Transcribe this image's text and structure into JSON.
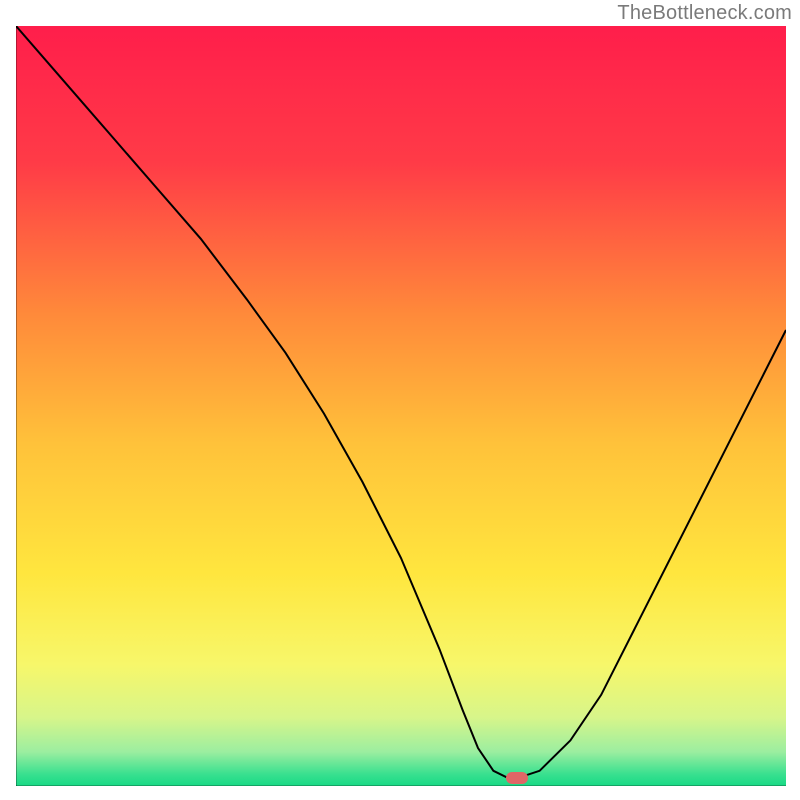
{
  "watermark": "TheBottleneck.com",
  "chart_data": {
    "type": "line",
    "title": "",
    "xlabel": "",
    "ylabel": "",
    "xlim": [
      0,
      100
    ],
    "ylim": [
      0,
      100
    ],
    "series": [
      {
        "name": "curve",
        "x": [
          0,
          6,
          12,
          18,
          24,
          30,
          35,
          40,
          45,
          50,
          55,
          58,
          60,
          62,
          64,
          65,
          68,
          72,
          76,
          80,
          84,
          88,
          92,
          96,
          100
        ],
        "y": [
          100,
          93,
          86,
          79,
          72,
          64,
          57,
          49,
          40,
          30,
          18,
          10,
          5,
          2,
          1,
          1,
          2,
          6,
          12,
          20,
          28,
          36,
          44,
          52,
          60
        ]
      }
    ],
    "marker": {
      "x": 65,
      "y": 1
    },
    "background_gradient": {
      "stops": [
        {
          "offset": 0,
          "color": "#ff1e4b"
        },
        {
          "offset": 0.18,
          "color": "#ff3b47"
        },
        {
          "offset": 0.38,
          "color": "#ff8a3a"
        },
        {
          "offset": 0.55,
          "color": "#ffc23a"
        },
        {
          "offset": 0.72,
          "color": "#ffe63e"
        },
        {
          "offset": 0.84,
          "color": "#f7f76a"
        },
        {
          "offset": 0.91,
          "color": "#d7f58a"
        },
        {
          "offset": 0.955,
          "color": "#9ceea0"
        },
        {
          "offset": 0.985,
          "color": "#37e08f"
        },
        {
          "offset": 1.0,
          "color": "#18d985"
        }
      ]
    },
    "axis_color": "#000000",
    "curve_color": "#000000",
    "marker_color": "#e06666"
  }
}
